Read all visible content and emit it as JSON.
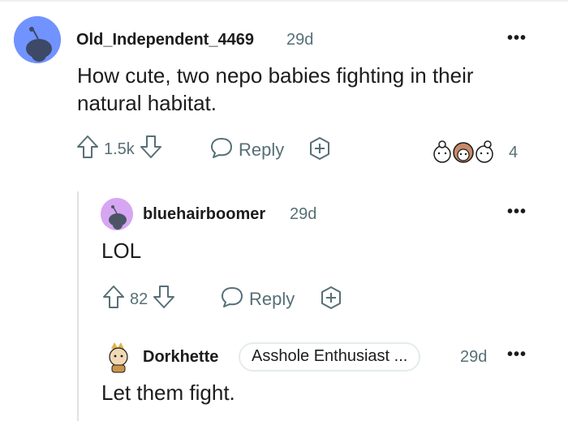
{
  "comments": [
    {
      "username": "Old_Independent_4469",
      "age": "29d",
      "text_lines": [
        "How cute, two nepo babies fighting in their",
        "natural habitat."
      ],
      "votes": "1.5k",
      "reply_label": "Reply",
      "awards_count": "4",
      "avatar_color": "#7193ff"
    },
    {
      "username": "bluehairboomer",
      "age": "29d",
      "text": "LOL",
      "votes": "82",
      "reply_label": "Reply",
      "avatar_color": "#d6a6f2"
    },
    {
      "username": "Dorkhette",
      "flair": "Asshole Enthusiast ...",
      "age": "29d",
      "text": "Let them fight."
    }
  ],
  "colors": {
    "meta_gray": "#576f76",
    "thread_line": "#dfe3e6"
  }
}
